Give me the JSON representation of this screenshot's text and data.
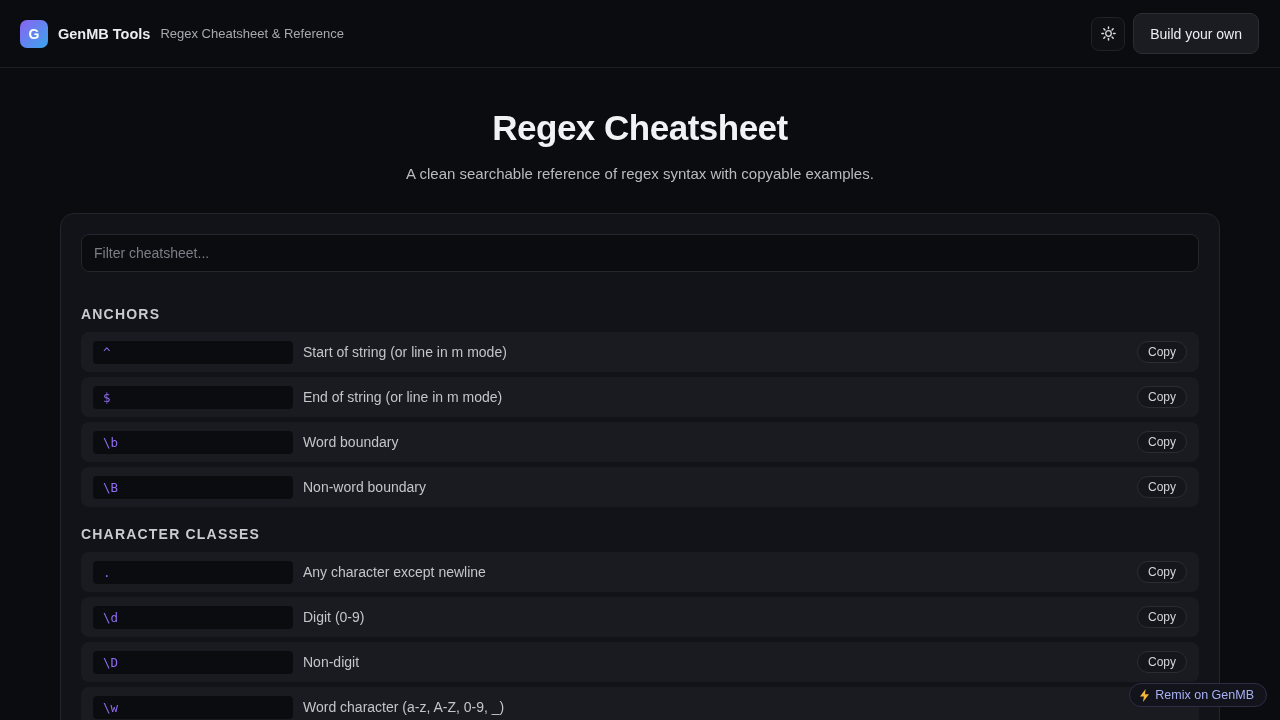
{
  "header": {
    "logo_letter": "G",
    "brand": "GenMB Tools",
    "subtitle": "Regex Cheatsheet & Reference",
    "build_button": "Build your own"
  },
  "hero": {
    "title": "Regex Cheatsheet",
    "subtitle": "A clean searchable reference of regex syntax with copyable examples."
  },
  "filter": {
    "placeholder": "Filter cheatsheet..."
  },
  "sections": [
    {
      "heading": "ANCHORS",
      "entries": [
        {
          "pattern": "^",
          "description": "Start of string (or line in m mode)",
          "copy_label": "Copy"
        },
        {
          "pattern": "$",
          "description": "End of string (or line in m mode)",
          "copy_label": "Copy"
        },
        {
          "pattern": "\\b",
          "description": "Word boundary",
          "copy_label": "Copy"
        },
        {
          "pattern": "\\B",
          "description": "Non-word boundary",
          "copy_label": "Copy"
        }
      ]
    },
    {
      "heading": "CHARACTER CLASSES",
      "entries": [
        {
          "pattern": ".",
          "description": "Any character except newline",
          "copy_label": "Copy"
        },
        {
          "pattern": "\\d",
          "description": "Digit (0-9)",
          "copy_label": "Copy"
        },
        {
          "pattern": "\\D",
          "description": "Non-digit",
          "copy_label": "Copy"
        },
        {
          "pattern": "\\w",
          "description": "Word character (a-z, A-Z, 0-9, _)"
        }
      ]
    }
  ],
  "remix_badge": {
    "label": "Remix on GenMB"
  }
}
